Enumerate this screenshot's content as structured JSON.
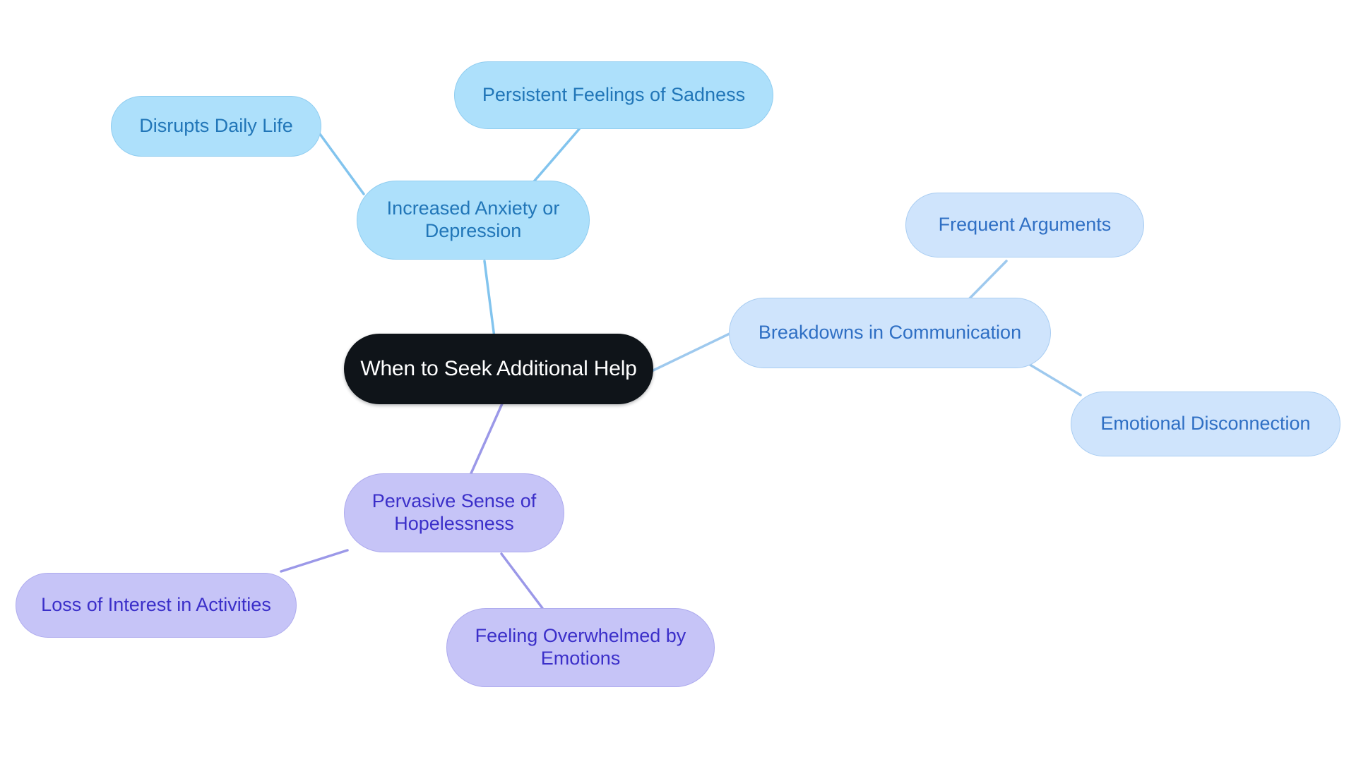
{
  "diagram": {
    "type": "mind-map",
    "background_color": "#ffffff",
    "root": {
      "id": "root",
      "label": "When to Seek Additional Help",
      "fill": "#0f1419",
      "text_color": "#ffffff"
    },
    "branches": [
      {
        "id": "branch-anxiety",
        "label": "Increased Anxiety or\nDepression",
        "fill": "#ade0fb",
        "text_color": "#2176b8",
        "edge_color": "#82c4ee",
        "children": [
          {
            "id": "child-disrupts-daily-life",
            "label": "Disrupts Daily Life",
            "fill": "#ade0fb",
            "text_color": "#2176b8"
          },
          {
            "id": "child-persistent-sadness",
            "label": "Persistent Feelings of Sadness",
            "fill": "#ade0fb",
            "text_color": "#2176b8"
          }
        ]
      },
      {
        "id": "branch-communication",
        "label": "Breakdowns in Communication",
        "fill": "#cfe4fc",
        "text_color": "#2f6fc4",
        "edge_color": "#9ec9ee",
        "children": [
          {
            "id": "child-frequent-arguments",
            "label": "Frequent Arguments",
            "fill": "#cfe4fc",
            "text_color": "#2f6fc4"
          },
          {
            "id": "child-emotional-disconnection",
            "label": "Emotional Disconnection",
            "fill": "#cfe4fc",
            "text_color": "#2f6fc4"
          }
        ]
      },
      {
        "id": "branch-hopelessness",
        "label": "Pervasive Sense of\nHopelessness",
        "fill": "#c6c4f7",
        "text_color": "#3b2fc9",
        "edge_color": "#9b98e8",
        "children": [
          {
            "id": "child-loss-of-interest",
            "label": "Loss of Interest in Activities",
            "fill": "#c6c4f7",
            "text_color": "#3b2fc9"
          },
          {
            "id": "child-feeling-overwhelmed",
            "label": "Feeling Overwhelmed by\nEmotions",
            "fill": "#c6c4f7",
            "text_color": "#3b2fc9"
          }
        ]
      }
    ]
  }
}
